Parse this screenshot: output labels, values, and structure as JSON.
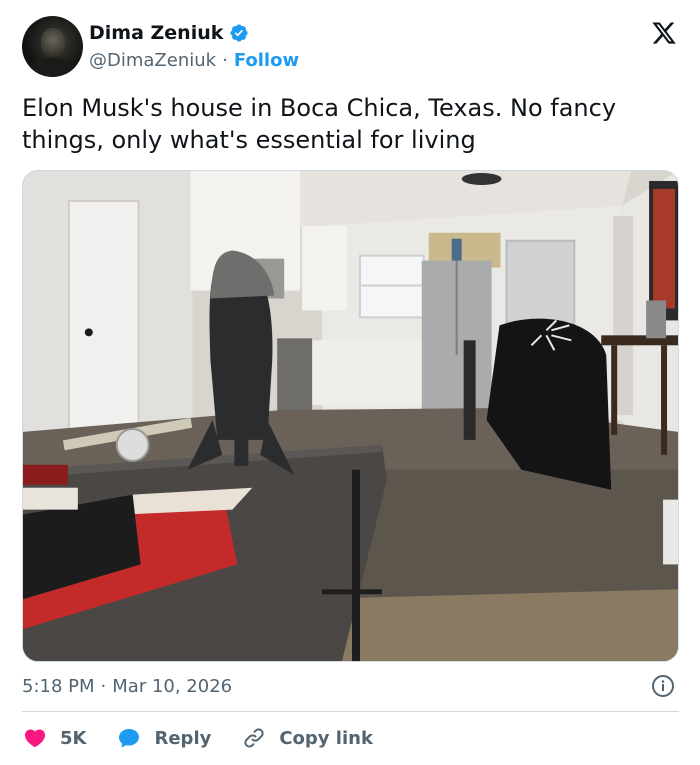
{
  "author": {
    "name": "Dima Zeniuk",
    "handle": "@DimaZeniuk",
    "separator": "·",
    "follow_label": "Follow",
    "verified": true
  },
  "brand": {
    "logo": "x-logo-icon"
  },
  "tweet": {
    "text": "Elon Musk's house in Boca Chica, Texas. No fancy things, only what's essential for living",
    "photo": "living-room-photo"
  },
  "meta": {
    "time": "5:18 PM",
    "separator": "·",
    "date": "Mar 10, 2026"
  },
  "actions": {
    "like_count": "5K",
    "reply_label": "Reply",
    "copy_label": "Copy link"
  },
  "colors": {
    "accent": "#1d9bf0",
    "like": "#f91880",
    "text": "#0f1419",
    "secondary": "#536471",
    "border": "#cfd9de"
  }
}
